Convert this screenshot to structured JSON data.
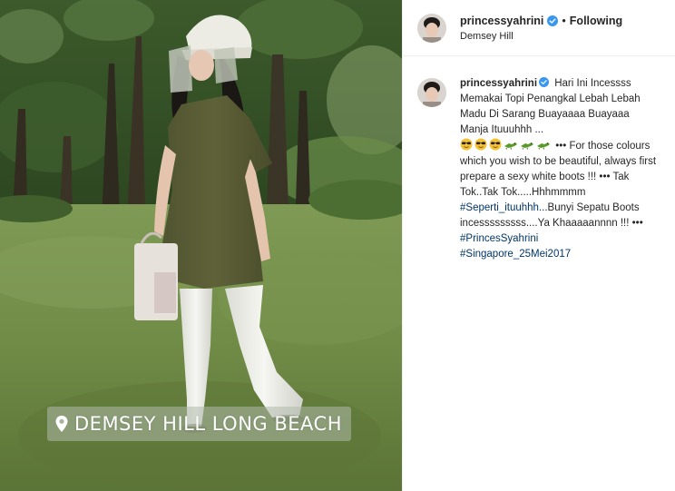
{
  "post": {
    "location_sticker": "DEMSEY HILL LONG BEACH"
  },
  "header": {
    "username": "princessyahrini",
    "separator": "•",
    "follow_status": "Following",
    "location": "Demsey Hill"
  },
  "caption": {
    "username": "princessyahrini",
    "text_1": "Hari Ini Incessss Memakai Topi Penangkal Lebah Lebah Madu Di Sarang Buayaaaa Buayaaa Manja Ituuuhhh ...",
    "emojis": [
      "sunglasses-face",
      "sunglasses-face",
      "sunglasses-face",
      "crocodile",
      "crocodile",
      "crocodile"
    ],
    "text_2": "••• For those colours which you wish to be beautiful, always first prepare a sexy white boots !!! ••• Tak Tok..Tak Tok.....Hhhmmmm",
    "hashtag_1": "#Seperti_ituuhhh",
    "text_3": "...Bunyi Sepatu Boots incesssssssss....Ya Khaaaaannnn !!! •••",
    "hashtag_2": "#PrincesSyahrini",
    "hashtag_3": "#Singapore_25Mei2017"
  },
  "colors": {
    "verified": "#3897f0",
    "hashtag": "#00376b",
    "text": "#262626",
    "divider": "#efefef"
  },
  "icons": {
    "verified": "verified-badge-icon",
    "location_pin": "location-pin-icon"
  }
}
